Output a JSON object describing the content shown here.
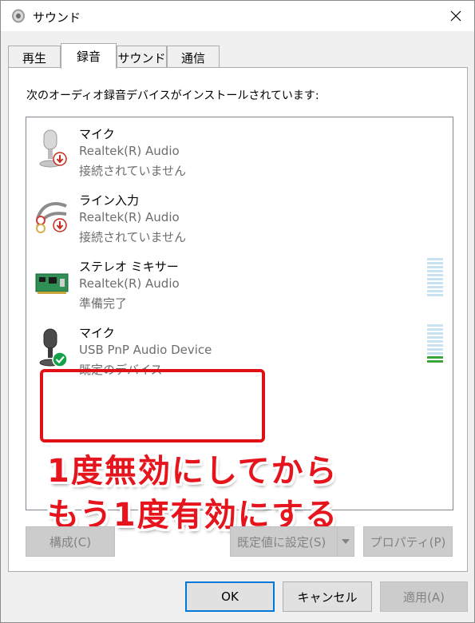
{
  "window": {
    "title": "サウンド"
  },
  "tabs": [
    {
      "label": "再生",
      "active": false
    },
    {
      "label": "録音",
      "active": true
    },
    {
      "label": "サウンド",
      "active": false
    },
    {
      "label": "通信",
      "active": false
    }
  ],
  "recording": {
    "instruction": "次のオーディオ録音デバイスがインストールされています:",
    "devices": [
      {
        "name": "マイク",
        "driver": "Realtek(R) Audio",
        "status": "接続されていません",
        "icon": "microphone-icon",
        "badge": "disconnected-badge-icon"
      },
      {
        "name": "ライン入力",
        "driver": "Realtek(R) Audio",
        "status": "接続されていません",
        "icon": "line-in-cable-icon",
        "badge": "disconnected-badge-icon"
      },
      {
        "name": "ステレオ ミキサー",
        "driver": "Realtek(R) Audio",
        "status": "準備完了",
        "icon": "sound-card-icon",
        "level": 0
      },
      {
        "name": "マイク",
        "driver": "USB PnP Audio Device",
        "status": "既定のデバイス",
        "icon": "microphone-icon",
        "badge": "default-check-icon",
        "level": 0.2
      }
    ]
  },
  "annotation": {
    "line1": "1度無効にしてから",
    "line2": "もう1度有効にする"
  },
  "buttons": {
    "configure": "構成(C)",
    "set_default": "既定値に設定(S)",
    "properties": "プロパティ(P)",
    "ok": "OK",
    "cancel": "キャンセル",
    "apply": "適用(A)"
  },
  "colors": {
    "annotation": "#e6141c",
    "accent": "#0078d7",
    "meter": "#c8e2ef",
    "meter_active": "#3aa53a"
  }
}
